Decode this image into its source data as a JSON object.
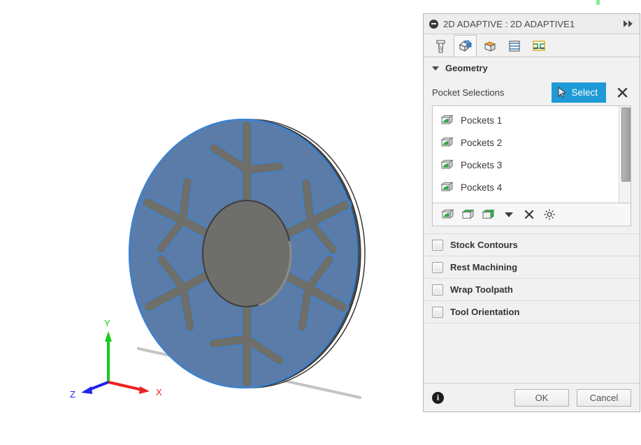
{
  "window": {
    "header_title": "2D ADAPTIVE : 2D ADAPTIVE1",
    "collapse_icon": "minus-circle-icon",
    "expand_icon": "fast-forward-icon"
  },
  "tabs": [
    {
      "id": "tool",
      "icon": "end-mill-tool-icon",
      "label": "Tool",
      "active": false
    },
    {
      "id": "geometry",
      "icon": "blue-cube-icon",
      "label": "Geometry",
      "active": true
    },
    {
      "id": "heights",
      "icon": "orange-cube-icon",
      "label": "Heights",
      "active": false
    },
    {
      "id": "passes",
      "icon": "stacked-lines-icon",
      "label": "Passes",
      "active": false
    },
    {
      "id": "linking",
      "icon": "linking-ramp-icon",
      "label": "Linking",
      "active": false
    }
  ],
  "geometry": {
    "title": "Geometry",
    "expanded": true,
    "caret_icon": "caret-down-icon",
    "pocket_selections_label": "Pocket Selections",
    "select_button_label": "Select",
    "select_button_icon": "cursor-arrow-icon",
    "select_button_color": "#1e9ad6",
    "clear_icon": "close-x-icon",
    "pockets": [
      {
        "icon": "green-face-icon",
        "label": "Pockets 1"
      },
      {
        "icon": "green-face-icon",
        "label": "Pockets 2"
      },
      {
        "icon": "green-face-icon",
        "label": "Pockets 3"
      },
      {
        "icon": "green-face-icon",
        "label": "Pockets 4"
      }
    ],
    "list_toolbar": [
      {
        "icon": "select-face-icon",
        "name": "select-face-mode"
      },
      {
        "icon": "select-top-face-icon",
        "name": "select-top-face-mode"
      },
      {
        "icon": "select-solid-icon",
        "name": "select-solid-mode"
      },
      {
        "icon": "caret-down-icon",
        "name": "selection-mode-dropdown"
      },
      {
        "icon": "close-x-icon",
        "name": "clear-selection"
      },
      {
        "icon": "gear-icon",
        "name": "selection-settings"
      }
    ],
    "scrollbar": {
      "thumb_percent": 75
    }
  },
  "sections": [
    {
      "id": "stock-contours",
      "label": "Stock Contours",
      "checked": false
    },
    {
      "id": "rest-machining",
      "label": "Rest Machining",
      "checked": false
    },
    {
      "id": "wrap-toolpath",
      "label": "Wrap Toolpath",
      "checked": false
    },
    {
      "id": "tool-orientation",
      "label": "Tool Orientation",
      "checked": false
    }
  ],
  "footer": {
    "info_icon": "info-icon",
    "info_glyph": "i",
    "ok_label": "OK",
    "cancel_label": "Cancel"
  },
  "viewport": {
    "model_name": "snowflake-disc-part",
    "body_color": "#5b7ca8",
    "pocket_color": "#6e6e6a",
    "highlight_color": "#2b7fd4",
    "axes": [
      {
        "axis": "X",
        "label": "X",
        "color": "#ee2222"
      },
      {
        "axis": "Y",
        "label": "Y",
        "color": "#17cc17"
      },
      {
        "axis": "Z",
        "label": "Z",
        "color": "#2222ee"
      }
    ],
    "ground_line_color": "#bdbdbd"
  }
}
